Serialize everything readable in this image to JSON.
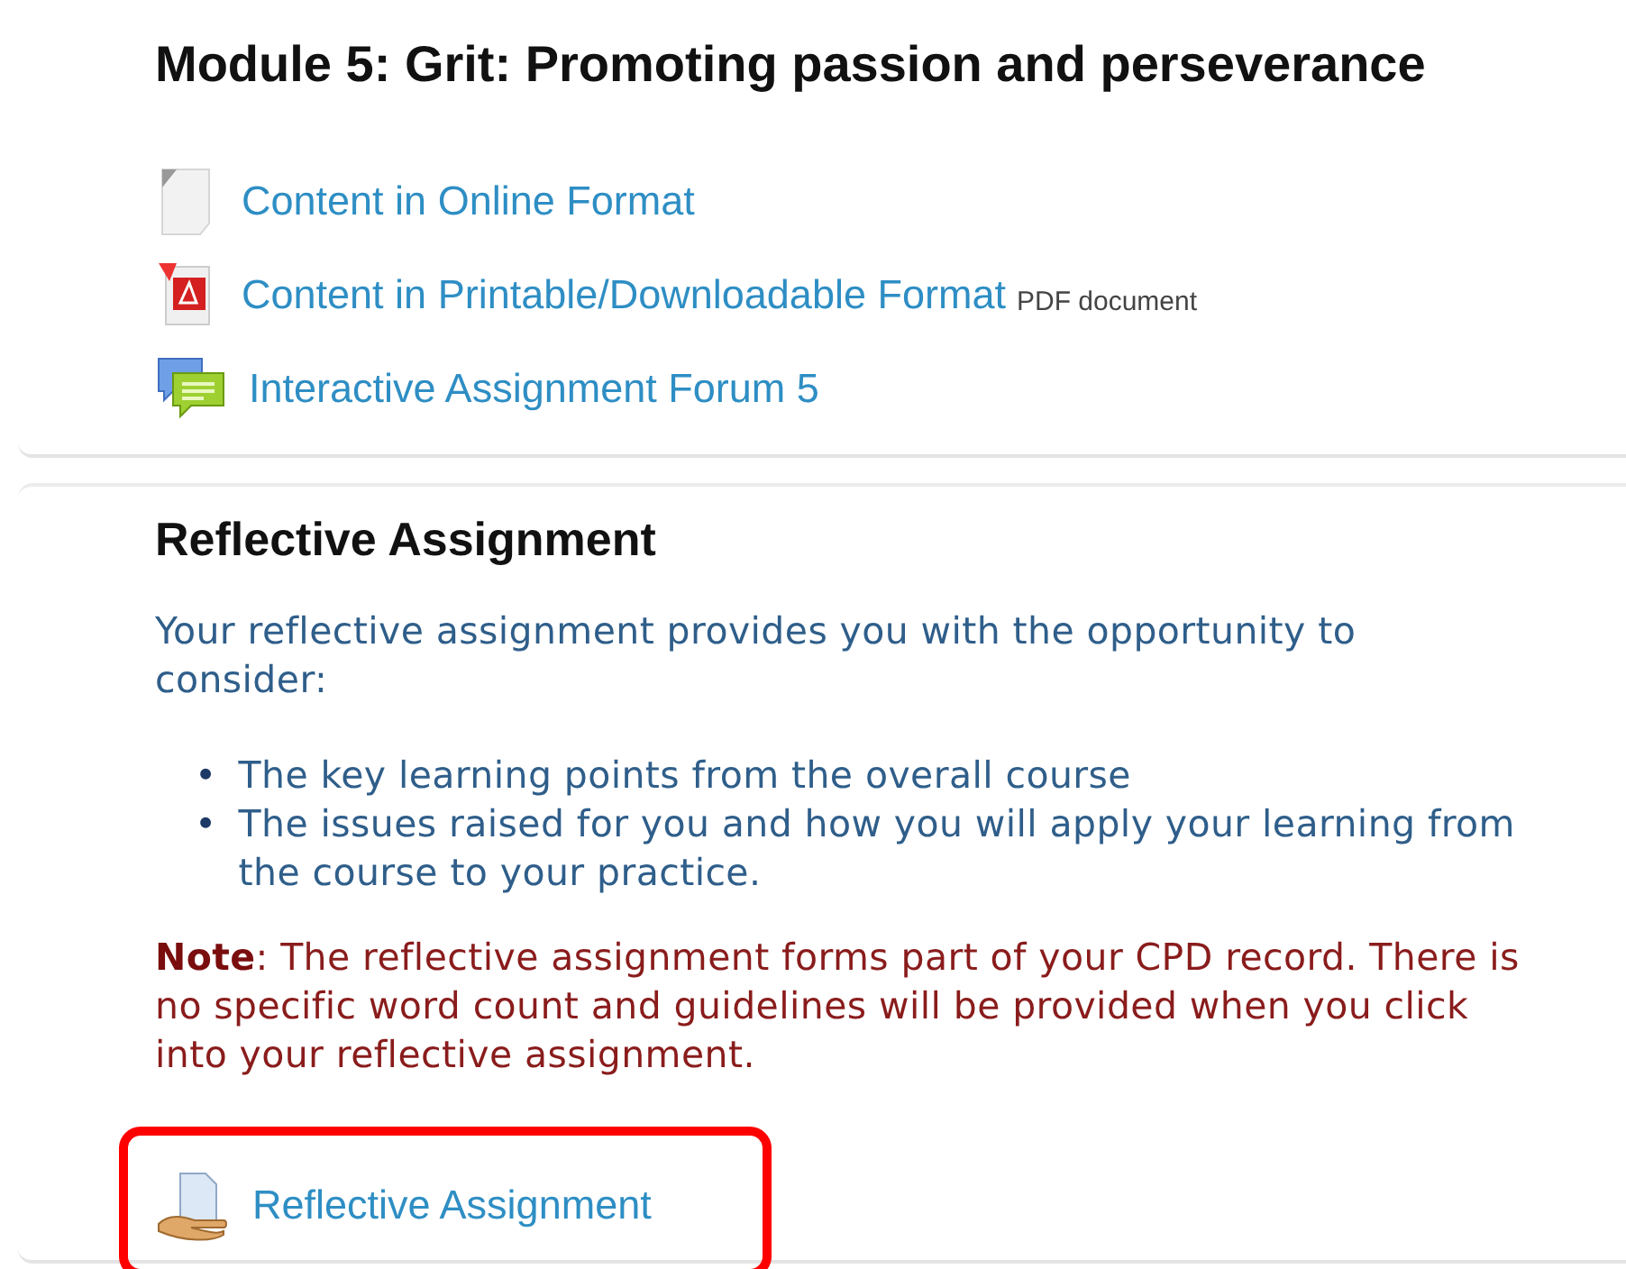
{
  "sections": [
    {
      "title": "Module 5: Grit: Promoting passion and perseverance",
      "activities": [
        {
          "kind": "page",
          "label": "Content in Online Format",
          "highlighted": false
        },
        {
          "kind": "pdf",
          "label": "Content in Printable/Downloadable Format",
          "suffix": "PDF document",
          "highlighted": false
        },
        {
          "kind": "forum",
          "label": "Interactive Assignment Forum 5",
          "highlighted": false
        }
      ]
    },
    {
      "title": "Reflective Assignment",
      "intro": "Your reflective assignment provides you with the opportunity to consider:",
      "bullets": [
        {
          "marker": "•",
          "text": "The key learning points from the overall course"
        },
        {
          "marker": "•",
          "text": "The issues raised for you and how you will apply your learning from the course to your practice."
        }
      ],
      "note": "**Note**: The reflective assignment forms part of your CPD record. There is no specific word count and guidelines will be provided when you click into your reflective assignment.",
      "activities": [
        {
          "kind": "assignment",
          "label": "Reflective Assignment",
          "highlighted": true
        }
      ]
    }
  ]
}
